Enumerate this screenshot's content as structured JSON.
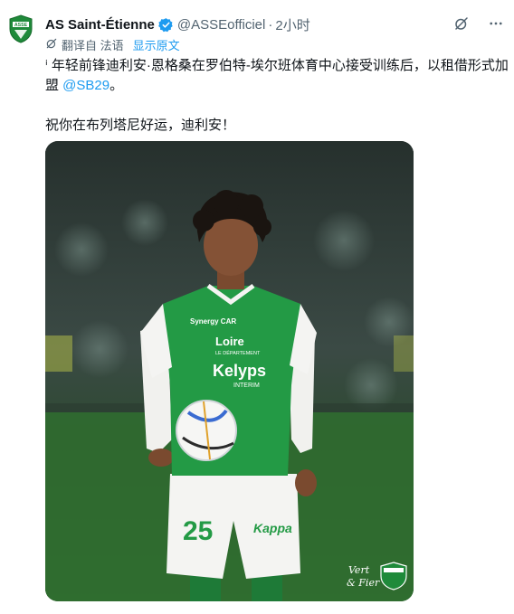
{
  "author": {
    "name": "AS Saint-Étienne",
    "handle": "@ASSEofficiel",
    "separator": "·",
    "time": "2小时"
  },
  "translation": {
    "label": "翻译自 法语",
    "show_original": "显示原文"
  },
  "tweet": {
    "line1_prefix": "ⁱ 年轻前锋迪利安·恩格桑在罗伯特-埃尔班体育中心接受训练后，以租借形式加盟 ",
    "mention": "@SB29",
    "line1_suffix": "。",
    "line2": "祝你在布列塔尼好运，迪利安！"
  },
  "photo": {
    "shirt_sponsor_top": "Synergy CAR",
    "shirt_sponsor_loire": "Loire",
    "shirt_sponsor_sub": "LE DÉPARTEMENT",
    "shirt_main_sponsor": "Kelyps",
    "shirt_main_sub": "INTERIM",
    "shorts_number": "25",
    "shorts_brand": "Kappa",
    "watermark_text_1": "Vert",
    "watermark_text_2": "& Fier",
    "crest_text": "ASSE"
  },
  "icons": {
    "verified": "verified-badge-icon",
    "grok": "grok-icon",
    "more": "more-icon",
    "translate": "translate-icon"
  },
  "colors": {
    "brand_green": "#1f8a3a",
    "link_blue": "#1d9bf0",
    "secondary_text": "#536471"
  }
}
